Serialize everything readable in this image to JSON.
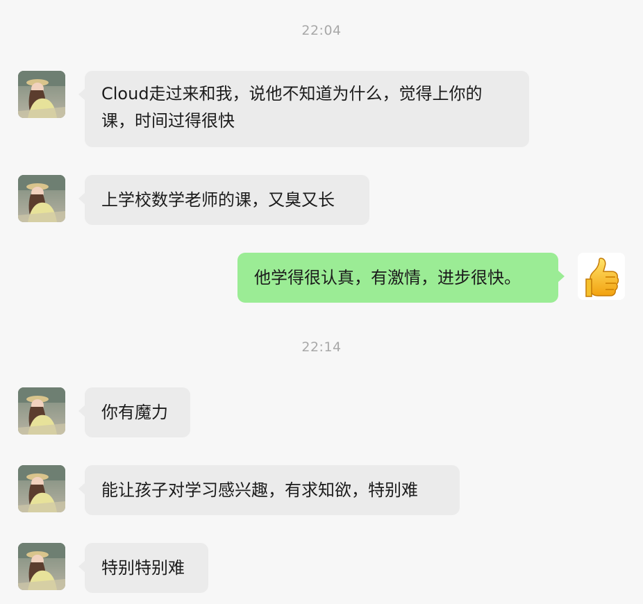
{
  "chat": {
    "timestamps": [
      "22:04",
      "22:14"
    ],
    "messages": [
      {
        "sender": "contact",
        "text": "Cloud走过来和我，说他不知道为什么，觉得上你的课，时间过得很快"
      },
      {
        "sender": "contact",
        "text": "上学校数学老师的课，又臭又长"
      },
      {
        "sender": "self",
        "text": "他学得很认真，有激情，进步很快。"
      },
      {
        "sender": "contact",
        "text": "你有魔力"
      },
      {
        "sender": "contact",
        "text": "能让孩子对学习感兴趣，有求知欲，特别难"
      },
      {
        "sender": "contact",
        "text": "特别特别难"
      }
    ]
  },
  "avatars": {
    "contact_icon": "contact-photo-icon",
    "self_icon": "thumbs-up-icon"
  },
  "colors": {
    "background": "#f7f7f7",
    "incoming_bubble": "#ebebeb",
    "outgoing_bubble": "#9bec95",
    "timestamp": "#a8a8a8",
    "text": "#1b1b1b"
  }
}
